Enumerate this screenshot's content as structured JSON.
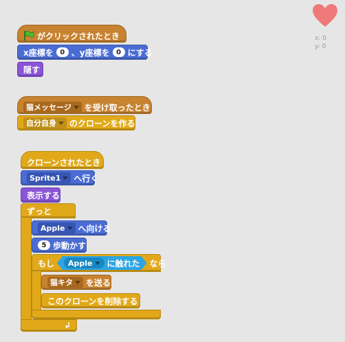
{
  "script1": {
    "hat_label": "がクリックされたとき",
    "goto_x_label": "x座標を",
    "goto_x_value": "0",
    "goto_mid_label": "、y座標を",
    "goto_y_value": "0",
    "goto_end_label": "にする",
    "hide_label": "隠す"
  },
  "script2": {
    "hat_dropdown": "猫メッセージ",
    "hat_label": "を受け取ったとき",
    "clone_dropdown": "自分自身",
    "clone_label": "のクローンを作る"
  },
  "script3": {
    "hat_label": "クローンされたとき",
    "goto_dropdown": "Sprite1",
    "goto_label": "へ行く",
    "show_label": "表示する",
    "forever_label": "ずっと",
    "point_dropdown": "Apple",
    "point_label": "へ向ける",
    "move_value": "5",
    "move_label": "歩動かす",
    "if_label": "もし",
    "touching_dropdown": "Apple",
    "touching_label": "に触れた",
    "then_label": "なら",
    "broadcast_dropdown": "猫キタ",
    "broadcast_label": "を送る",
    "delete_label": "このクローンを削除する"
  },
  "stage": {
    "x_label": "x: 0",
    "y_label": "y: 0",
    "sprite_icon": "heart-icon",
    "heart_color": "#f07a7a"
  }
}
